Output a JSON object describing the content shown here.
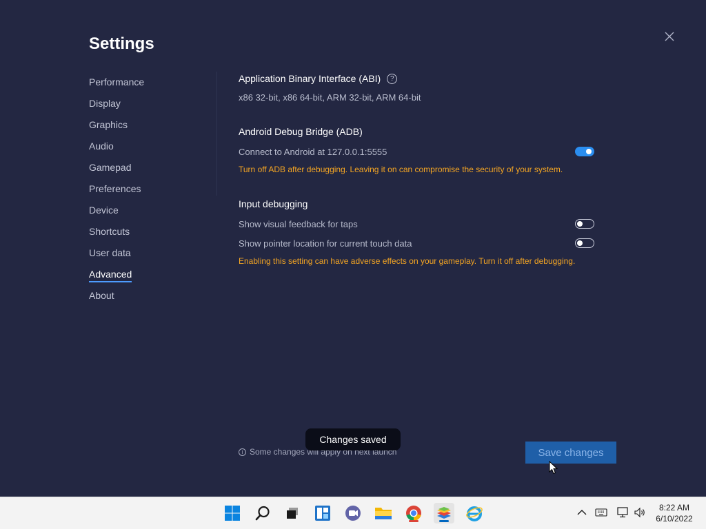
{
  "window": {
    "title": "Settings"
  },
  "sidebar": {
    "items": [
      {
        "label": "Performance"
      },
      {
        "label": "Display"
      },
      {
        "label": "Graphics"
      },
      {
        "label": "Audio"
      },
      {
        "label": "Gamepad"
      },
      {
        "label": "Preferences"
      },
      {
        "label": "Device"
      },
      {
        "label": "Shortcuts"
      },
      {
        "label": "User data"
      },
      {
        "label": "Advanced",
        "active": true
      },
      {
        "label": "About"
      }
    ]
  },
  "abi": {
    "title": "Application Binary Interface (ABI)",
    "help_icon": "question-circle-icon",
    "value": "x86 32-bit, x86 64-bit, ARM 32-bit, ARM 64-bit"
  },
  "adb": {
    "title": "Android Debug Bridge (ADB)",
    "label": "Connect to Android at 127.0.0.1:5555",
    "enabled": true,
    "warning": "Turn off ADB after debugging. Leaving it on can compromise the security of your system."
  },
  "input_debugging": {
    "title": "Input debugging",
    "options": [
      {
        "label": "Show visual feedback for taps",
        "enabled": false
      },
      {
        "label": "Show pointer location for current touch data",
        "enabled": false
      }
    ],
    "warning": "Enabling this setting can have adverse effects on your gameplay. Turn it off after debugging."
  },
  "toast": {
    "text": "Changes saved"
  },
  "footer": {
    "note": "Some changes will apply on next launch",
    "save_label": "Save changes"
  },
  "taskbar": {
    "apps": [
      "start-icon",
      "search-icon",
      "task-view-icon",
      "widgets-icon",
      "teams-chat-icon",
      "file-explorer-icon",
      "chrome-icon",
      "bluestacks-icon",
      "internet-explorer-icon"
    ],
    "clock_time": "8:22 AM",
    "clock_date": "6/10/2022"
  },
  "colors": {
    "background": "#232742",
    "accent": "#2b8ef0",
    "warning": "#f5a623",
    "save_button": "#1f5fa8"
  }
}
